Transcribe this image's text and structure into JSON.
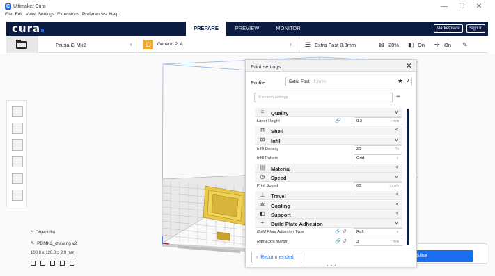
{
  "window": {
    "title": "Ultimaker Cura",
    "minimize": "—",
    "maximize": "❐",
    "close": "✕"
  },
  "menu": [
    "File",
    "Edit",
    "View",
    "Settings",
    "Extensions",
    "Preferences",
    "Help"
  ],
  "header": {
    "brand": "cura",
    "stages": [
      "PREPARE",
      "PREVIEW",
      "MONITOR"
    ],
    "active_stage": "PREPARE",
    "marketplace": "Marketplace",
    "signin": "Sign In"
  },
  "toolbar": {
    "printer": "Prusa i3 Mk2",
    "material": "Generic PLA",
    "profile_summary": "Extra Fast 0.3mm",
    "infill": "20%",
    "support": "On",
    "adhesion": "On"
  },
  "object_list": {
    "header": "Object list",
    "name": "PDMK2_drawing v2",
    "dimensions": "100.8 x 120.0 x 2.9 mm"
  },
  "slice_button": "Slice",
  "panel": {
    "title": "Print settings",
    "close": "✕",
    "profile_label": "Profile",
    "profile_value": "Extra Fast",
    "profile_extra": "0.3mm",
    "search_placeholder": "search settings",
    "recommended": "Recommended",
    "rows": [
      {
        "type": "cat",
        "label": "Quality",
        "icon": "≡",
        "chevron": "∨"
      },
      {
        "type": "set",
        "label": "Layer Height",
        "value": "0.3",
        "unit": "mm",
        "link": true
      },
      {
        "type": "cat",
        "label": "Shell",
        "icon": "⊓",
        "chevron": "<"
      },
      {
        "type": "cat",
        "label": "Infill",
        "icon": "⊠",
        "chevron": "∨"
      },
      {
        "type": "set",
        "label": "Infill Density",
        "value": "20",
        "unit": "%"
      },
      {
        "type": "set",
        "label": "Infill Pattern",
        "value": "Grid",
        "unit": "∨"
      },
      {
        "type": "cat",
        "label": "Material",
        "icon": "|||",
        "chevron": "<"
      },
      {
        "type": "cat",
        "label": "Speed",
        "icon": "◷",
        "chevron": "∨"
      },
      {
        "type": "set",
        "label": "Print Speed",
        "value": "60",
        "unit": "mm/s"
      },
      {
        "type": "cat",
        "label": "Travel",
        "icon": "⊥",
        "chevron": "<"
      },
      {
        "type": "cat",
        "label": "Cooling",
        "icon": "✲",
        "chevron": "<"
      },
      {
        "type": "cat",
        "label": "Support",
        "icon": "◧",
        "chevron": "<"
      },
      {
        "type": "cat",
        "label": "Build Plate Adhesion",
        "icon": "+",
        "chevron": "∨"
      },
      {
        "type": "set",
        "label": "Build Plate Adhesion Type",
        "value": "Raft",
        "unit": "∨",
        "link": true,
        "reset": true,
        "italic": true
      },
      {
        "type": "set",
        "label": "Raft Extra Margin",
        "value": "3",
        "unit": "mm",
        "link": true,
        "reset": true,
        "italic": true
      }
    ]
  },
  "colors": {
    "header_bg": "#0c1b41",
    "accent": "#196ef0",
    "material": "#f5a623",
    "model": "#e8c84a"
  }
}
